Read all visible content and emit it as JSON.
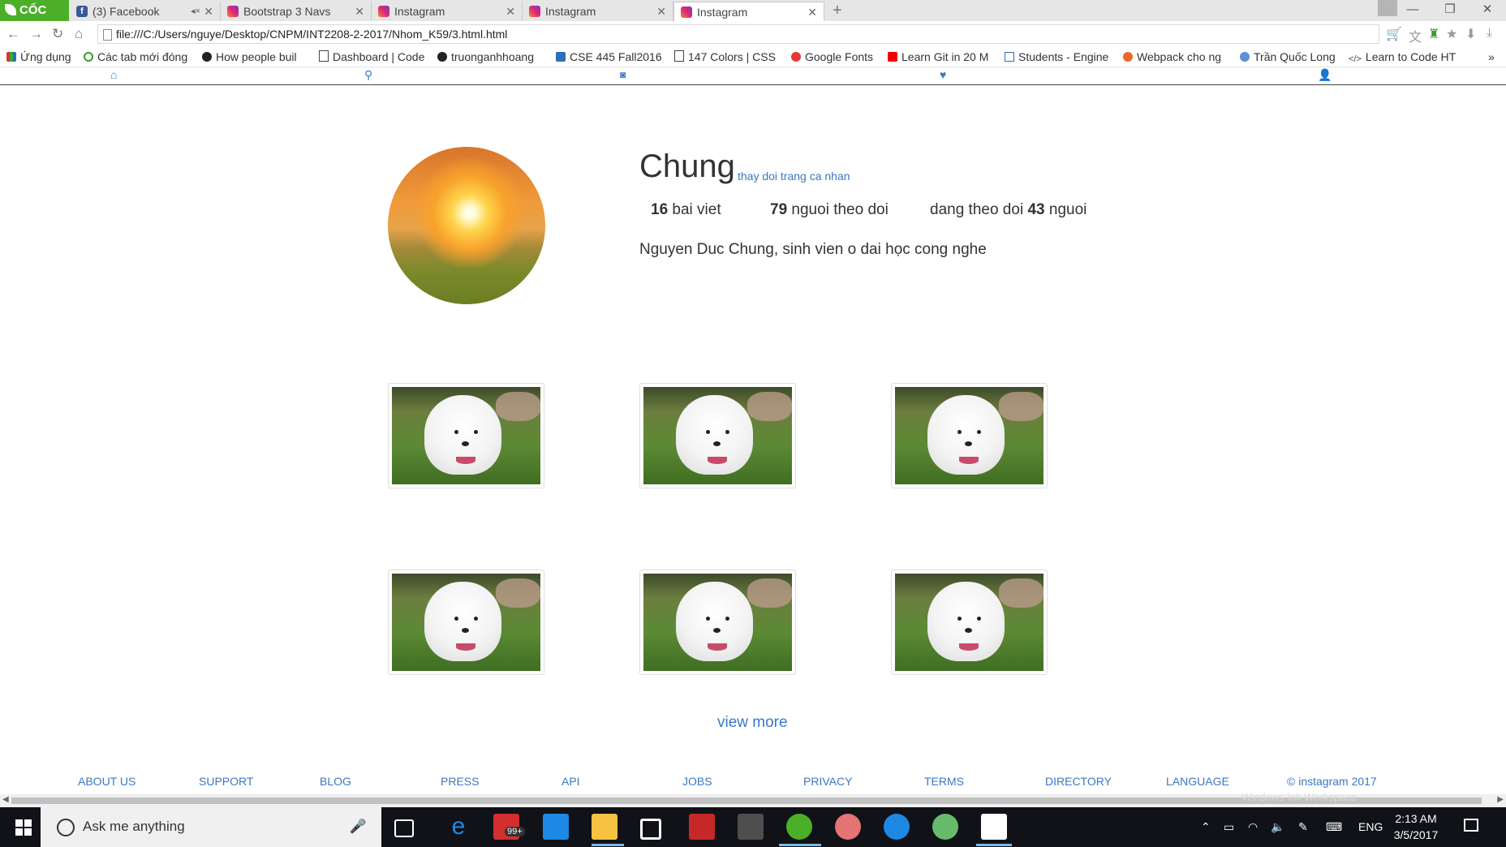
{
  "browser": {
    "brand": "CỐC CỐC",
    "tabs": [
      {
        "title": "(3) Facebook",
        "favicon": "facebook-icon",
        "muted_icon": "speaker-muted-icon",
        "active": false
      },
      {
        "title": "Bootstrap 3 Navs",
        "favicon": "instagram-icon",
        "active": false
      },
      {
        "title": "Instagram",
        "favicon": "instagram-icon",
        "active": false
      },
      {
        "title": "Instagram",
        "favicon": "instagram-icon",
        "active": false
      },
      {
        "title": "Instagram",
        "favicon": "instagram-icon",
        "active": true
      }
    ],
    "address": "file:///C:/Users/nguye/Desktop/CNPM/INT2208-2-2017/Nhom_K59/3.html.html",
    "bookmarks": [
      "Ứng dụng",
      "Các tab mới đóng",
      "How people buil",
      "Dashboard | Code",
      "truonganhhoang",
      "CSE 445 Fall2016",
      "147 Colors | CSS",
      "Google Fonts",
      "Learn Git in 20 M",
      "Students - Engine",
      "Webpack cho ng",
      "Trần Quốc Long",
      "Learn to Code HT"
    ]
  },
  "page": {
    "nav": [
      "home-icon",
      "search-icon",
      "camera-icon",
      "heart-icon",
      "user-icon"
    ],
    "profile": {
      "username": "Chung",
      "edit_link": "thay doi trang ca nhan",
      "posts_count": "16",
      "posts_label": "bai viet",
      "followers_count": "79",
      "followers_label": "nguoi theo doi",
      "following_prefix": "dang theo doi",
      "following_count": "43",
      "following_suffix": "nguoi",
      "bio": "Nguyen Duc Chung, sinh vien o dai học cong nghe"
    },
    "view_more": "view more",
    "footer": {
      "links": [
        "ABOUT US",
        "SUPPORT",
        "BLOG",
        "PRESS",
        "API",
        "JOBS",
        "PRIVACY",
        "TERMS",
        "DIRECTORY",
        "LANGUAGE"
      ],
      "copyright": "© instagram 2017"
    },
    "overlay_hint": "Windows Ink Workspace"
  },
  "taskbar": {
    "search_placeholder": "Ask me anything",
    "badge": "99+",
    "language": "ENG",
    "time": "2:13 AM",
    "date": "3/5/2017"
  },
  "colors": {
    "link": "#3a78c3",
    "brand_green": "#4caf2a",
    "taskbar": "#101218"
  }
}
